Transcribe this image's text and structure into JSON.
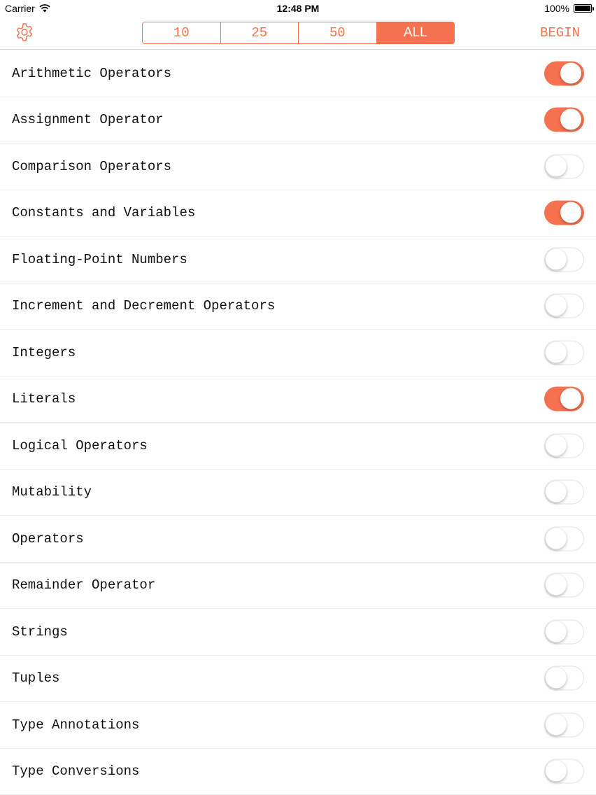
{
  "status": {
    "carrier": "Carrier",
    "time": "12:48 PM",
    "battery": "100%"
  },
  "nav": {
    "segments": [
      "10",
      "25",
      "50",
      "ALL"
    ],
    "active_segment": "ALL",
    "begin_label": "BEGIN"
  },
  "colors": {
    "accent": "#f5714f"
  },
  "topics": [
    {
      "label": "Arithmetic Operators",
      "on": true
    },
    {
      "label": "Assignment Operator",
      "on": true
    },
    {
      "label": "Comparison Operators",
      "on": false
    },
    {
      "label": "Constants and Variables",
      "on": true
    },
    {
      "label": "Floating-Point Numbers",
      "on": false
    },
    {
      "label": "Increment and Decrement Operators",
      "on": false
    },
    {
      "label": "Integers",
      "on": false
    },
    {
      "label": "Literals",
      "on": true
    },
    {
      "label": "Logical Operators",
      "on": false
    },
    {
      "label": "Mutability",
      "on": false
    },
    {
      "label": "Operators",
      "on": false
    },
    {
      "label": "Remainder Operator",
      "on": false
    },
    {
      "label": "Strings",
      "on": false
    },
    {
      "label": "Tuples",
      "on": false
    },
    {
      "label": "Type Annotations",
      "on": false
    },
    {
      "label": "Type Conversions",
      "on": false
    }
  ]
}
